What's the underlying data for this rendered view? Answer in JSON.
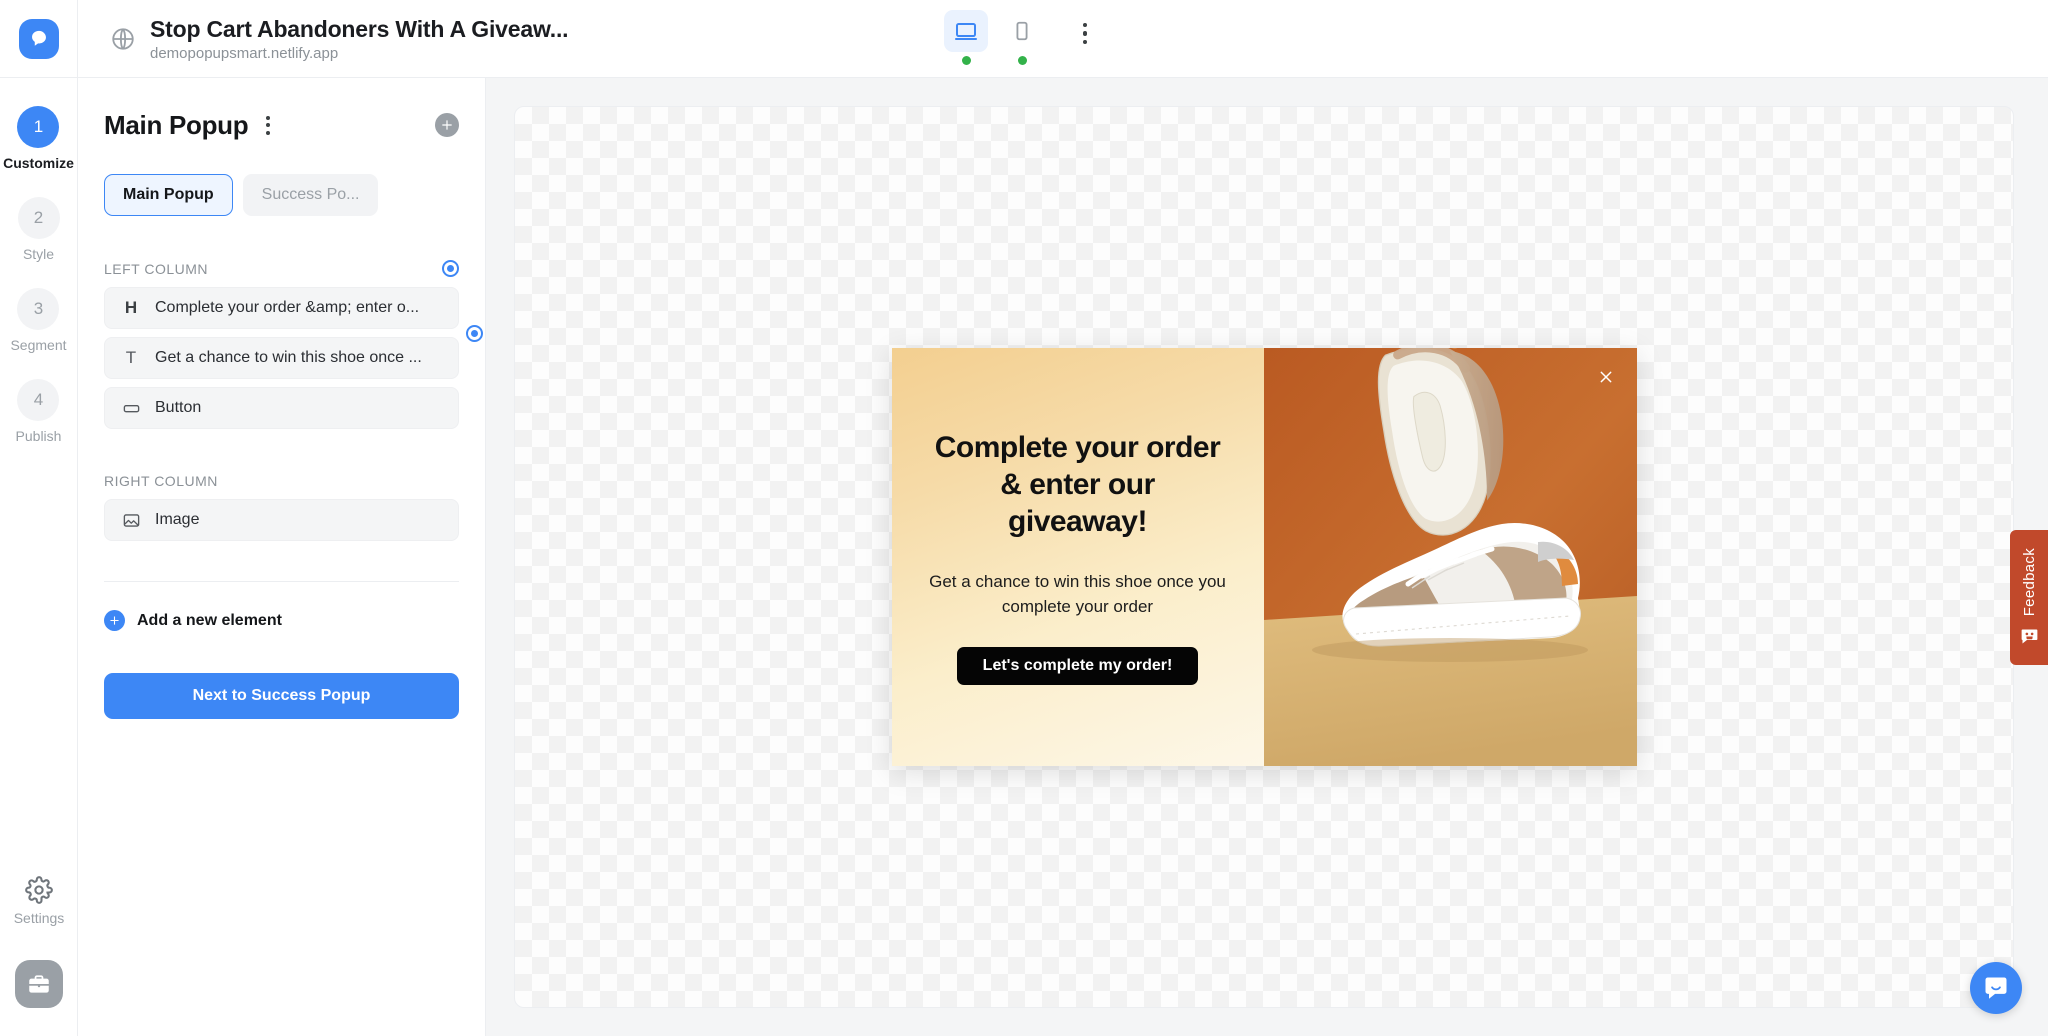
{
  "app": {
    "logo_icon": "popupsmart-logo-icon"
  },
  "header": {
    "globe_icon": "globe-icon",
    "site_title": "Stop Cart Abandoners With A Giveaw...",
    "site_url": "demopopupsmart.netlify.app",
    "devices": [
      {
        "id": "desktop",
        "icon": "desktop-icon",
        "active": true,
        "status_dot": "#33b24a"
      },
      {
        "id": "mobile",
        "icon": "mobile-icon",
        "active": false,
        "status_dot": "#33b24a"
      }
    ],
    "more_icon": "kebab-menu-icon"
  },
  "rail": {
    "steps": [
      {
        "number": "1",
        "label": "Customize",
        "active": true
      },
      {
        "number": "2",
        "label": "Style",
        "active": false
      },
      {
        "number": "3",
        "label": "Segment",
        "active": false
      },
      {
        "number": "4",
        "label": "Publish",
        "active": false
      }
    ],
    "settings_label": "Settings",
    "settings_icon": "gear-icon",
    "briefcase_icon": "briefcase-icon"
  },
  "panel": {
    "title": "Main Popup",
    "kebab_icon": "kebab-menu-icon",
    "add_icon": "plus-circle-icon",
    "tabs": [
      {
        "label": "Main Popup",
        "active": true
      },
      {
        "label": "Success Po...",
        "active": false
      }
    ],
    "left_column": {
      "title": "LEFT COLUMN",
      "radio_icon": "radio-selected-icon",
      "items": [
        {
          "icon": "heading-icon",
          "icon_glyph": "H",
          "label": "Complete your order &amp; enter o...",
          "has_radio": false
        },
        {
          "icon": "text-icon",
          "icon_glyph": "T",
          "label": "Get a chance to win this shoe once ...",
          "has_radio": true
        },
        {
          "icon": "button-icon",
          "icon_glyph": "",
          "label": "Button",
          "has_radio": false
        }
      ]
    },
    "right_column": {
      "title": "RIGHT COLUMN",
      "items": [
        {
          "icon": "image-icon",
          "label": "Image"
        }
      ]
    },
    "add_element": {
      "label": "Add a new element",
      "icon": "plus-circle-icon"
    },
    "next_button": "Next to Success Popup"
  },
  "popup_preview": {
    "heading": "Complete your order & enter our giveaway!",
    "paragraph": "Get a chance to win this shoe once you complete your order",
    "cta_label": "Let's complete my order!",
    "close_icon": "close-icon",
    "image_alt": "sneaker-product-photo",
    "colors": {
      "left_gradient_start": "#f3cf90",
      "left_gradient_end": "#fdf7e8",
      "cta_background": "#050505",
      "image_backdrop": "#c4672a",
      "image_floor": "#dcb878"
    }
  },
  "feedback": {
    "label": "Feedback",
    "icon": "smiley-face-icon",
    "color": "#c1492b"
  },
  "chat": {
    "icon": "chat-bubble-icon",
    "color": "#3d87f5"
  }
}
